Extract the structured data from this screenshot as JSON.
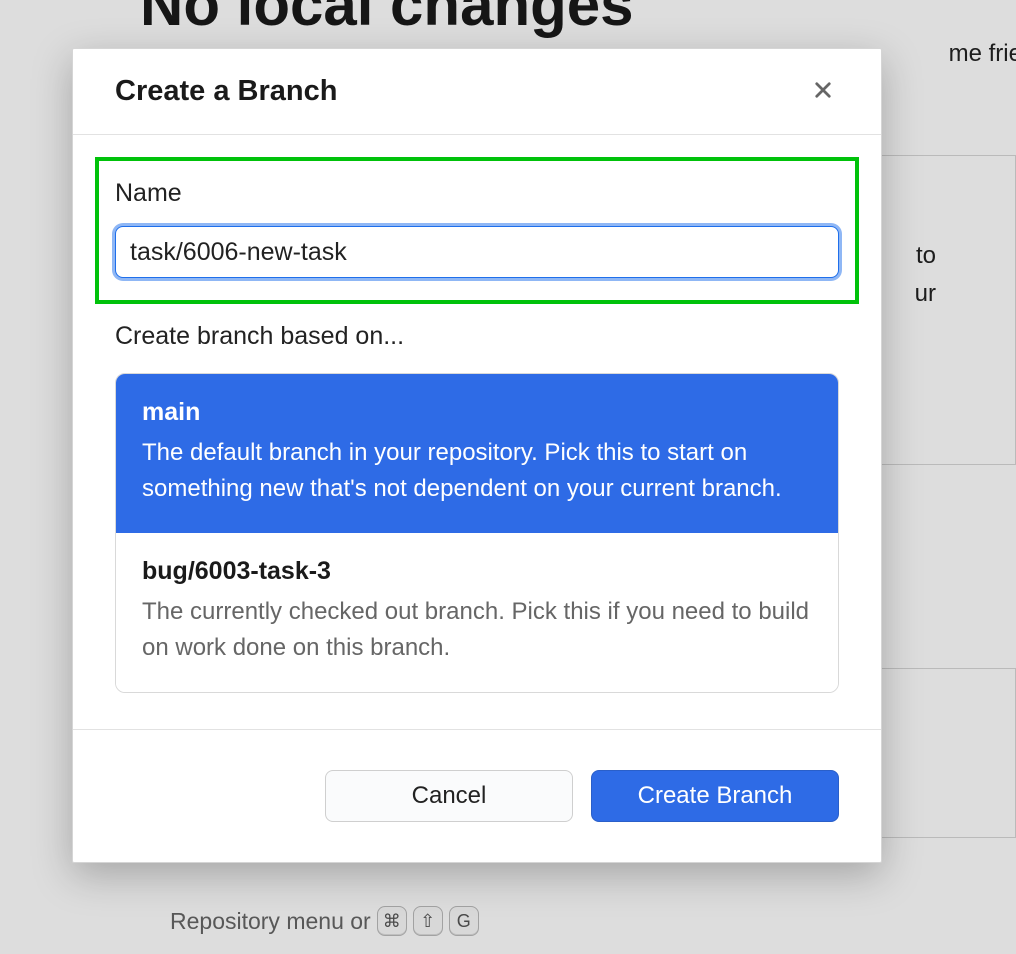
{
  "background": {
    "heading": "No local changes",
    "friendly_fragment": "me friendly",
    "to_fragment": "to",
    "ur_fragment": "ur",
    "bottom_hint_text": "Repository menu or",
    "kbd": {
      "cmd": "⌘",
      "shift": "⇧",
      "g": "G"
    }
  },
  "dialog": {
    "title": "Create a Branch",
    "name_label": "Name",
    "name_value": "task/6006-new-task",
    "based_on_label": "Create branch based on...",
    "options": [
      {
        "name": "main",
        "desc": "The default branch in your repository. Pick this to start on something new that's not dependent on your current branch.",
        "selected": true
      },
      {
        "name": "bug/6003-task-3",
        "desc": "The currently checked out branch. Pick this if you need to build on work done on this branch.",
        "selected": false
      }
    ],
    "cancel_label": "Cancel",
    "submit_label": "Create Branch"
  }
}
